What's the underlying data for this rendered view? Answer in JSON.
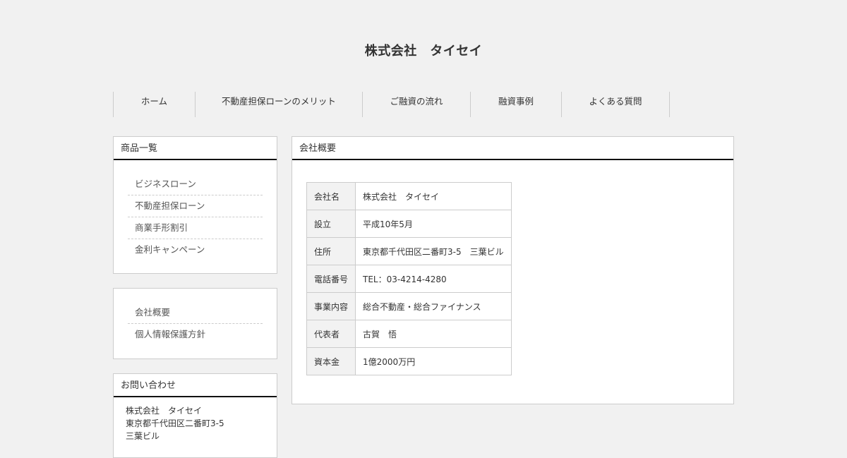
{
  "site": {
    "title": "株式会社　タイセイ"
  },
  "nav": {
    "items": [
      {
        "label": "ホーム"
      },
      {
        "label": "不動産担保ローンのメリット"
      },
      {
        "label": "ご融資の流れ"
      },
      {
        "label": "融資事例"
      },
      {
        "label": "よくある質問"
      }
    ]
  },
  "sidebar": {
    "products": {
      "heading": "商品一覧",
      "items": [
        {
          "label": "ビジネスローン"
        },
        {
          "label": "不動産担保ローン"
        },
        {
          "label": "商業手形割引"
        },
        {
          "label": "金利キャンペーン"
        }
      ]
    },
    "company_links": {
      "items": [
        {
          "label": "会社概要"
        },
        {
          "label": "個人情報保護方針"
        }
      ]
    },
    "contact": {
      "heading": "お問い合わせ",
      "lines": [
        "株式会社　タイセイ",
        "東京都千代田区二番町3-5",
        "三葉ビル"
      ]
    }
  },
  "main": {
    "heading": "会社概要",
    "table": [
      {
        "label": "会社名",
        "value": "株式会社　タイセイ"
      },
      {
        "label": "設立",
        "value": "平成10年5月"
      },
      {
        "label": "住所",
        "value": "東京都千代田区二番町3-5　三葉ビル"
      },
      {
        "label": "電話番号",
        "value": "TEL：03-4214-4280"
      },
      {
        "label": "事業内容",
        "value": "総合不動産・総合ファイナンス"
      },
      {
        "label": "代表者",
        "value": "古賀　悟"
      },
      {
        "label": "資本金",
        "value": "1億2000万円"
      }
    ]
  }
}
